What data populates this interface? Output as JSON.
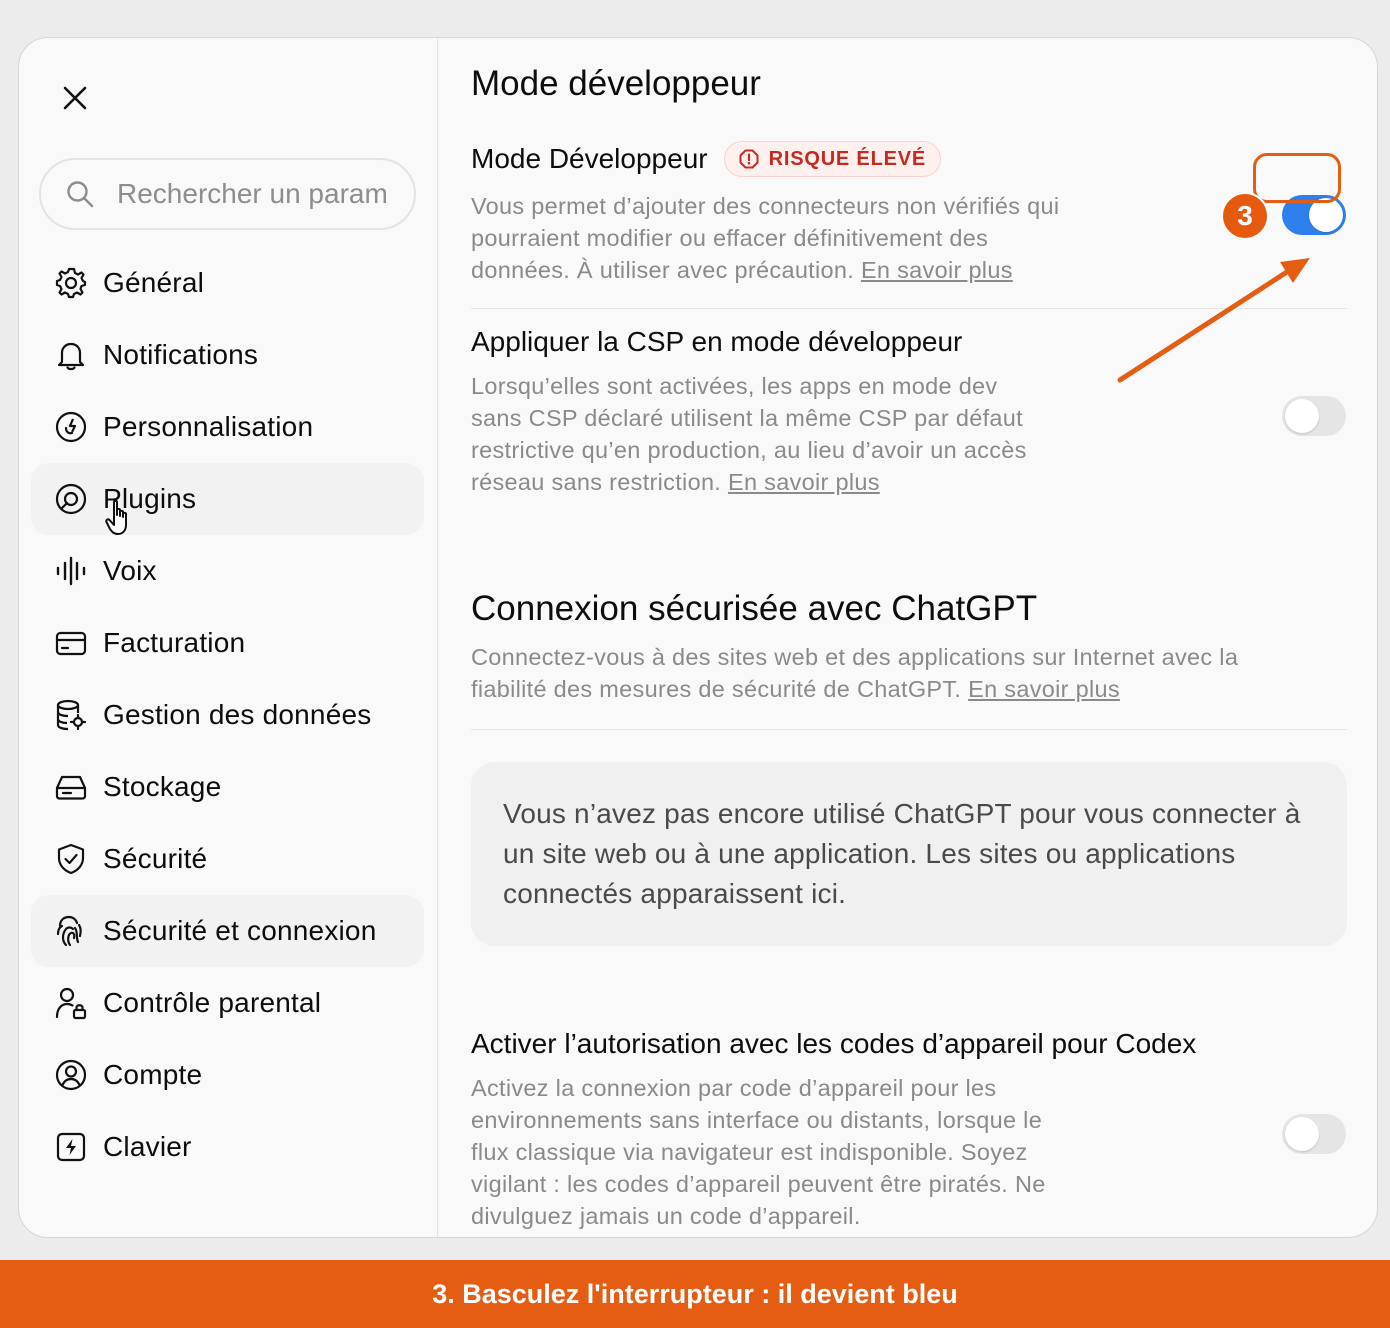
{
  "search": {
    "placeholder": "Rechercher un param"
  },
  "sidebar": {
    "items": [
      {
        "label": "Général",
        "icon": "gear-icon"
      },
      {
        "label": "Notifications",
        "icon": "bell-icon"
      },
      {
        "label": "Personnalisation",
        "icon": "personalization-icon"
      },
      {
        "label": "Plugins",
        "icon": "plugins-icon"
      },
      {
        "label": "Voix",
        "icon": "waveform-icon"
      },
      {
        "label": "Facturation",
        "icon": "credit-card-icon"
      },
      {
        "label": "Gestion des données",
        "icon": "database-gear-icon"
      },
      {
        "label": "Stockage",
        "icon": "storage-icon"
      },
      {
        "label": "Sécurité",
        "icon": "shield-check-icon"
      },
      {
        "label": "Sécurité et connexion",
        "icon": "security-login-icon"
      },
      {
        "label": "Contrôle parental",
        "icon": "parental-control-icon"
      },
      {
        "label": "Compte",
        "icon": "account-icon"
      },
      {
        "label": "Clavier",
        "icon": "keyboard-icon"
      }
    ]
  },
  "main": {
    "title": "Mode développeur",
    "dev_mode": {
      "title": "Mode Développeur",
      "badge": "RISQUE ÉLEVÉ",
      "desc": "Vous permet d’ajouter des connecteurs non vérifiés qui pourraient modifier ou effacer définitivement des données. À utiliser avec précaution.",
      "link": "En savoir plus",
      "enabled": true
    },
    "csp": {
      "title": "Appliquer la CSP en mode développeur",
      "desc": "Lorsqu’elles sont activées, les apps en mode dev sans CSP déclaré utilisent la même CSP par défaut restrictive qu’en production, au lieu d’avoir un accès réseau sans restriction.",
      "link": "En savoir plus",
      "enabled": false
    },
    "secure": {
      "title": "Connexion sécurisée avec ChatGPT",
      "desc": "Connectez-vous à des sites web et des applications sur Internet avec la fiabilité des mesures de sécurité de ChatGPT.",
      "link": "En savoir plus",
      "empty": "Vous n’avez pas encore utilisé ChatGPT pour vous connecter à un site web ou à une application. Les sites ou applications connectés apparaissent ici."
    },
    "device_codes": {
      "title": "Activer l’autorisation avec les codes d’appareil pour Codex",
      "desc": "Activez la connexion par code d’appareil pour les environnements sans interface ou distants, lorsque le flux classique via navigateur est indisponible. Soyez vigilant : les codes d’appareil peuvent être piratés. Ne divulguez jamais un code d’appareil.",
      "enabled": false
    }
  },
  "annotation": {
    "step": "3",
    "caption": "3. Basculez l'interrupteur : il devient bleu",
    "color": "#e55d12"
  },
  "colors": {
    "toggle_on": "#2f80ed",
    "risk": "#c62a1f"
  }
}
